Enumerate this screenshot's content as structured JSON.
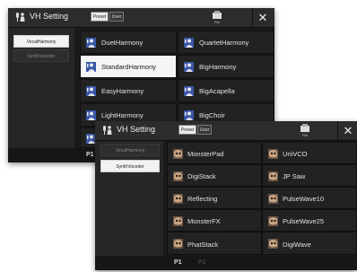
{
  "back_window": {
    "title": "VH Setting",
    "preset_label": "Preset",
    "user_label": "User",
    "file_label": "File",
    "close_label": "✕",
    "sidebar": [
      "VocalHarmony",
      "SynthVocoder"
    ],
    "presets": [
      {
        "label": "DuetHarmony",
        "selected": false
      },
      {
        "label": "QuartetHarmony",
        "selected": false
      },
      {
        "label": "StandardHarmony",
        "selected": true
      },
      {
        "label": "BigHarmony",
        "selected": false
      },
      {
        "label": "EasyHarmony",
        "selected": false
      },
      {
        "label": "BigAcapella",
        "selected": false
      },
      {
        "label": "LightHarmony",
        "selected": false
      },
      {
        "label": "BigChoir",
        "selected": false
      }
    ],
    "page_label": "P1"
  },
  "front_window": {
    "title": "VH Setting",
    "preset_label": "Preset",
    "user_label": "User",
    "file_label": "File",
    "close_label": "✕",
    "sidebar": [
      "VocalHarmony",
      "SynthVocoder"
    ],
    "presets": [
      {
        "label": "MonsterPad"
      },
      {
        "label": "UniVCO"
      },
      {
        "label": "DigiStack"
      },
      {
        "label": "JP Saw"
      },
      {
        "label": "Reflecting"
      },
      {
        "label": "PulseWave10"
      },
      {
        "label": "MonsterFX"
      },
      {
        "label": "PulseWave25"
      },
      {
        "label": "PhatStack"
      },
      {
        "label": "DigiWave"
      }
    ],
    "pages": [
      "P1",
      "P2"
    ]
  },
  "colors": {
    "selected_background": "#f5f5f5",
    "panel_background": "#1a1a1a",
    "sidebar_selected": "#f2f2f2"
  },
  "icons": {
    "vocal_preset": "person-with-microphone-icon",
    "synth_preset": "synth-face-icon"
  }
}
